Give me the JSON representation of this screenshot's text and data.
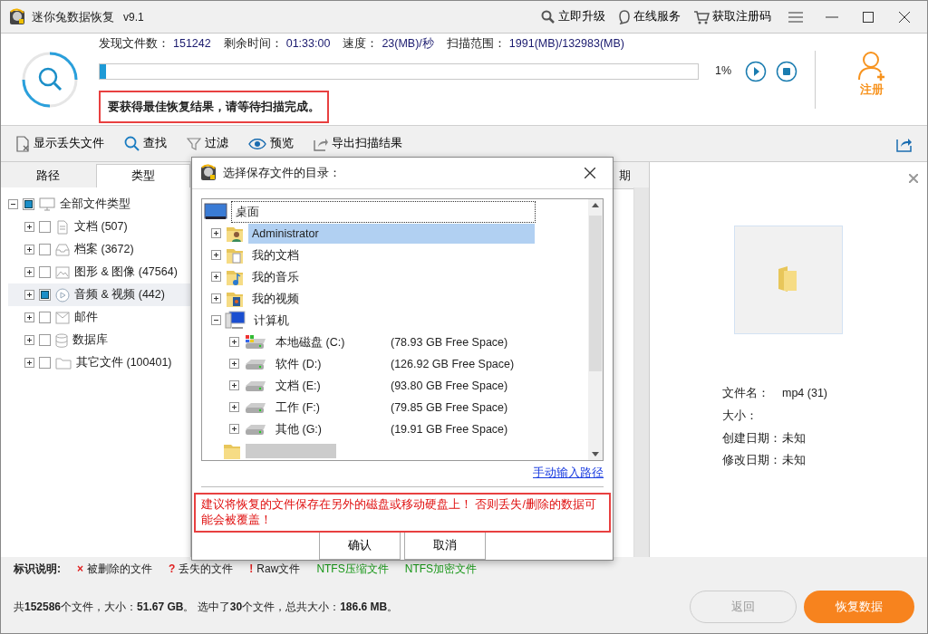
{
  "window": {
    "app_name": "迷你兔数据恢复",
    "version": "v9.1"
  },
  "title_actions": [
    {
      "label": "立即升级",
      "kind": "key"
    },
    {
      "label": "在线服务",
      "kind": "bubble"
    },
    {
      "label": "获取注册码",
      "kind": "cart"
    }
  ],
  "scan": {
    "stats": [
      {
        "label": "发现文件数：",
        "value": "151242"
      },
      {
        "label": "剩余时间：",
        "value": "01:33:00"
      },
      {
        "label": "速度：",
        "value": "23(MB)/秒"
      },
      {
        "label": "扫描范围：",
        "value": "1991(MB)/132983(MB)"
      }
    ],
    "level": 0.01,
    "percent": "1%",
    "tip": "要获得最佳恢复结果，请等待扫描完成。"
  },
  "register": {
    "label": "注册"
  },
  "toolbar": [
    {
      "label": "显示丢失文件",
      "kind": "file"
    },
    {
      "label": "查找",
      "kind": "search"
    },
    {
      "label": "过滤",
      "kind": "filter"
    },
    {
      "label": "预览",
      "kind": "eye"
    },
    {
      "label": "导出扫描结果",
      "kind": "export"
    }
  ],
  "left_tabs": [
    {
      "label": "路径",
      "selected": false
    },
    {
      "label": "类型",
      "selected": true
    }
  ],
  "type_tree": {
    "label": "全部文件类型",
    "kind": "monitor",
    "checked": true,
    "expanded": true,
    "children": [
      {
        "label": "文档 (507)",
        "kind": "doc",
        "checked": false,
        "selected": false
      },
      {
        "label": "档案 (3672)",
        "kind": "archive",
        "checked": false,
        "selected": false
      },
      {
        "label": "图形 & 图像 (47564)",
        "kind": "image",
        "checked": false,
        "selected": false
      },
      {
        "label": "音频 & 视频 (442)",
        "kind": "media",
        "checked": true,
        "selected": true
      },
      {
        "label": "邮件",
        "kind": "mail",
        "checked": false,
        "selected": false
      },
      {
        "label": "数据库",
        "kind": "database",
        "checked": false,
        "selected": false
      },
      {
        "label": "其它文件 (100401)",
        "kind": "folder",
        "checked": false,
        "selected": false
      }
    ]
  },
  "file_list": {
    "column_header": "期"
  },
  "preview": {
    "fields": [
      {
        "label": "文件名：",
        "value": "mp4 (31)"
      },
      {
        "label": "大小："
      },
      {
        "label": "创建日期：",
        "value": "未知"
      },
      {
        "label": "修改日期：",
        "value": "未知"
      }
    ]
  },
  "legend": {
    "title": "标识说明:",
    "items": [
      {
        "symbol": "×",
        "label": "被删除的文件",
        "color": "#e02020"
      },
      {
        "symbol": "?",
        "label": "丢失的文件",
        "color": "#e02020"
      },
      {
        "symbol": "!",
        "label": "Raw文件",
        "color": "#e02020"
      },
      {
        "label": "NTFS压缩文件",
        "color": "#169616"
      },
      {
        "label": "NTFS加密文件",
        "color": "#169616"
      }
    ]
  },
  "status": {
    "summary": "共**152586**个文件，大小：**51.67 GB**。 选中了**30**个文件，总共大小：**186.6 MB**。"
  },
  "buttons": [
    {
      "label": "返回",
      "disabled": true
    },
    {
      "label": "恢复数据",
      "disabled": false
    }
  ],
  "dialog": {
    "title": "选择保存文件的目录：",
    "tree": {
      "label": "桌面",
      "kind": "desktop",
      "children": [
        {
          "label": "Administrator",
          "kind": "user",
          "expanded": false,
          "selected": true
        },
        {
          "label": "我的文档",
          "kind": "docs",
          "expanded": false,
          "selected": false
        },
        {
          "label": "我的音乐",
          "kind": "music",
          "expanded": false,
          "selected": false
        },
        {
          "label": "我的视频",
          "kind": "video",
          "expanded": false,
          "selected": false
        },
        {
          "label": "计算机",
          "kind": "computer",
          "expanded": true,
          "selected": false,
          "children": [
            {
              "label": "本地磁盘 (C:)",
              "free": "(78.93 GB Free Space)",
              "kind": "system-drive",
              "expanded": false,
              "selected": false
            },
            {
              "label": "软件 (D:)",
              "free": "(126.92 GB Free Space)",
              "kind": "drive",
              "expanded": false,
              "selected": false
            },
            {
              "label": "文档 (E:)",
              "free": "(93.80 GB Free Space)",
              "kind": "drive",
              "expanded": false,
              "selected": false
            },
            {
              "label": "工作 (F:)",
              "free": "(79.85 GB Free Space)",
              "kind": "drive",
              "expanded": false,
              "selected": false
            },
            {
              "label": "其他 (G:)",
              "free": "(19.91 GB Free Space)",
              "kind": "drive",
              "expanded": false,
              "selected": false
            }
          ]
        },
        {
          "kind": "blurred"
        }
      ]
    },
    "manual_link": "手动输入路径",
    "warning": "建议将恢复的文件保存在另外的磁盘或移动硬盘上！ 否则丢失/删除的数据可能会被覆盖！",
    "buttons": [
      "确认",
      "取消"
    ]
  }
}
